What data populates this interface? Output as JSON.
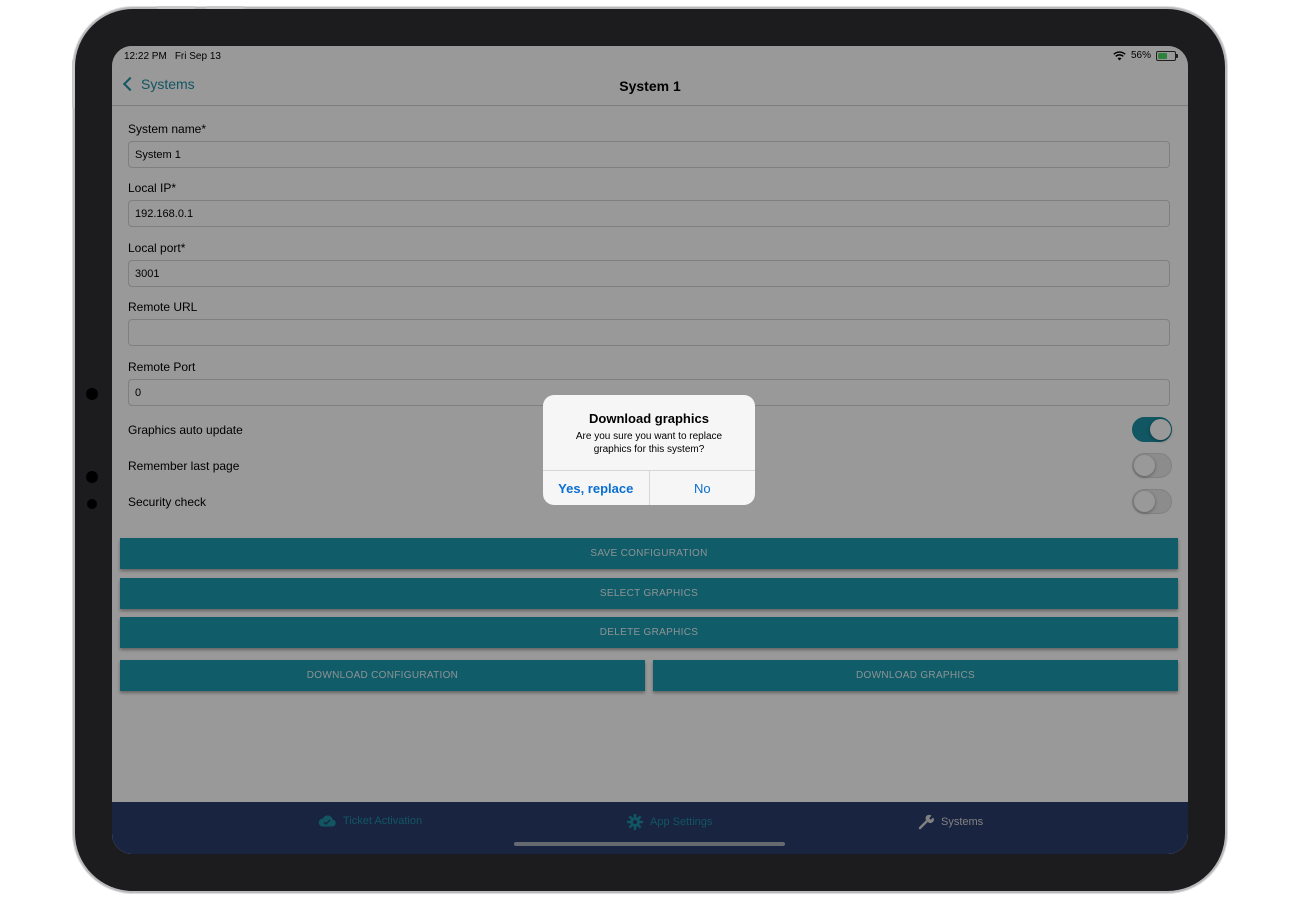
{
  "status_bar": {
    "time": "12:22 PM",
    "date": "Fri Sep 13",
    "battery": "56%",
    "battery_level": 0.56
  },
  "nav": {
    "back_label": "Systems",
    "title": "System 1"
  },
  "form": {
    "system_name": {
      "label": "System name*",
      "value": "System 1"
    },
    "local_ip": {
      "label": "Local IP*",
      "value": "192.168.0.1"
    },
    "local_port": {
      "label": "Local port*",
      "value": "3001"
    },
    "remote_url": {
      "label": "Remote URL",
      "value": ""
    },
    "remote_port": {
      "label": "Remote Port",
      "value": "0"
    },
    "graphics_auto_update": {
      "label": "Graphics auto update",
      "on": true
    },
    "remember_last_page": {
      "label": "Remember last page",
      "on": false
    },
    "security_check": {
      "label": "Security check",
      "on": false
    }
  },
  "actions": {
    "save_configuration": "SAVE CONFIGURATION",
    "select_graphics": "SELECT GRAPHICS",
    "delete_graphics": "DELETE GRAPHICS",
    "download_configuration": "DOWNLOAD CONFIGURATION",
    "download_graphics": "DOWNLOAD GRAPHICS"
  },
  "tabs": [
    {
      "label": "Ticket Activation",
      "icon": "cloud-check-icon",
      "active": false
    },
    {
      "label": "App Settings",
      "icon": "gear-icon",
      "active": false
    },
    {
      "label": "Systems",
      "icon": "wrench-icon",
      "active": true
    }
  ],
  "alert": {
    "title": "Download graphics",
    "message": "Are you sure you want to replace graphics for this system?",
    "confirm_label": "Yes, replace",
    "cancel_label": "No"
  },
  "colors": {
    "accent": "#1d8fa3",
    "button": "#1c99b0",
    "tab_bar": "#2a3d6b",
    "alert_action": "#0a6fd1"
  }
}
